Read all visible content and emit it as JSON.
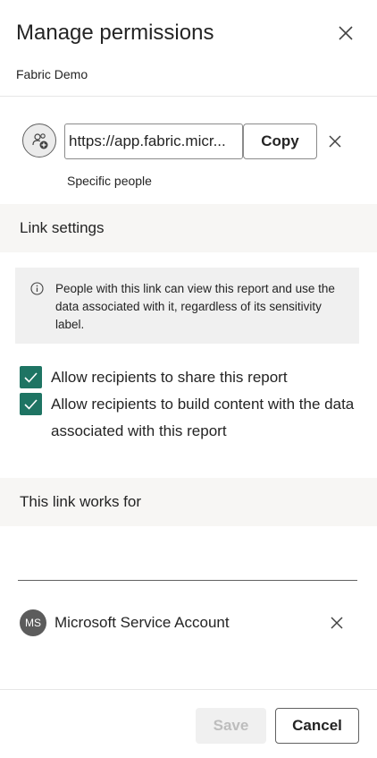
{
  "dialog": {
    "title": "Manage permissions",
    "subtitle": "Fabric Demo",
    "close_icon": "close-icon"
  },
  "link": {
    "add_people_icon": "add-people-icon",
    "url": "https://app.fabric.micr...",
    "copy_label": "Copy",
    "clear_icon": "close-icon",
    "scope_label": "Specific people"
  },
  "link_settings": {
    "header": "Link settings",
    "info_icon": "info-icon",
    "info_text": "People with this link can view this report and use the data associated with it, regardless of its sensitivity label.",
    "options": [
      {
        "label": "Allow recipients to share this report",
        "checked": true
      },
      {
        "label": "Allow recipients to build content with the data associated with this report",
        "checked": true
      }
    ]
  },
  "works_for": {
    "header": "This link works for",
    "input_value": "",
    "people": [
      {
        "initials": "MS",
        "name": "Microsoft Service Account"
      }
    ]
  },
  "footer": {
    "save_label": "Save",
    "save_enabled": false,
    "cancel_label": "Cancel"
  },
  "colors": {
    "accent": "#1e7463",
    "text": "#242424",
    "section_bg": "#f7f6f4"
  }
}
